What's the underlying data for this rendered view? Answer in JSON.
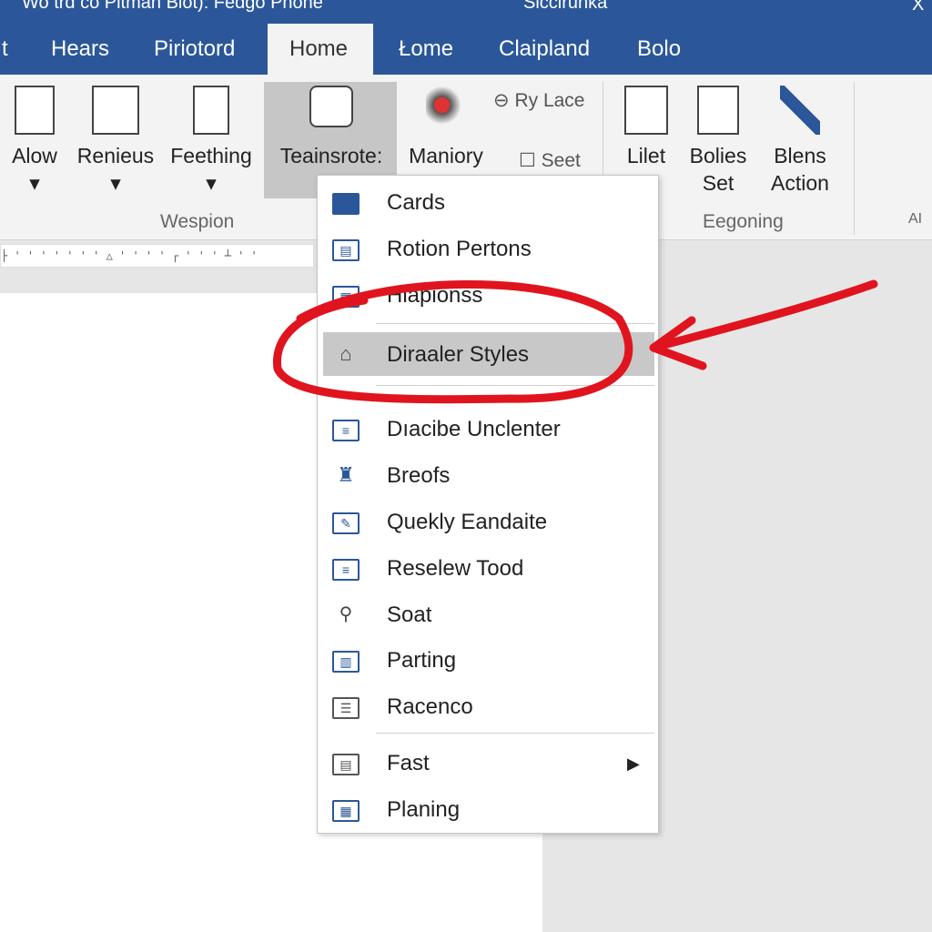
{
  "titlebar": {
    "title": "Wo trd co Pitman Blot): Fedgo Phone",
    "account": "Siccirunka",
    "close": "X"
  },
  "tabs": [
    "t",
    "Hears",
    "Piriotord",
    "Home",
    "Łome",
    "Claipland",
    "Bolo"
  ],
  "ribbon": {
    "buttons": [
      "Alow",
      "Renieus",
      "Feething",
      "Teainsrote:",
      "Maniory",
      "Lilet",
      "Bolies Set",
      "Blens Action"
    ],
    "small": [
      "Ry Lace",
      "Seet"
    ],
    "groups": [
      "Wespion",
      "Eegoning",
      "AI"
    ]
  },
  "menu": {
    "items": [
      {
        "label": "Cards",
        "icon": "folder-icon"
      },
      {
        "label": "Rotion Pertons",
        "icon": "clipboard-icon"
      },
      {
        "label": "Hlapionss",
        "icon": "table-icon"
      },
      {
        "label": "Diraaler Styles",
        "icon": "home-icon",
        "highlighted": true
      },
      {
        "label": "Dıacibe Unclenter",
        "icon": "document-icon"
      },
      {
        "label": "Breofs",
        "icon": "stamp-icon"
      },
      {
        "label": "Quekly Eandaite",
        "icon": "edit-icon"
      },
      {
        "label": "Reselew Tood",
        "icon": "page-icon"
      },
      {
        "label": "Soat",
        "icon": "search-icon"
      },
      {
        "label": "Parting",
        "icon": "chart-icon"
      },
      {
        "label": "Racenco",
        "icon": "list-icon"
      },
      {
        "label": "Fast",
        "icon": "keyboard-icon",
        "submenu": true
      },
      {
        "label": "Planing",
        "icon": "calendar-icon"
      }
    ]
  },
  "annotation_color": "#e0141e",
  "accent": "#2b579a"
}
